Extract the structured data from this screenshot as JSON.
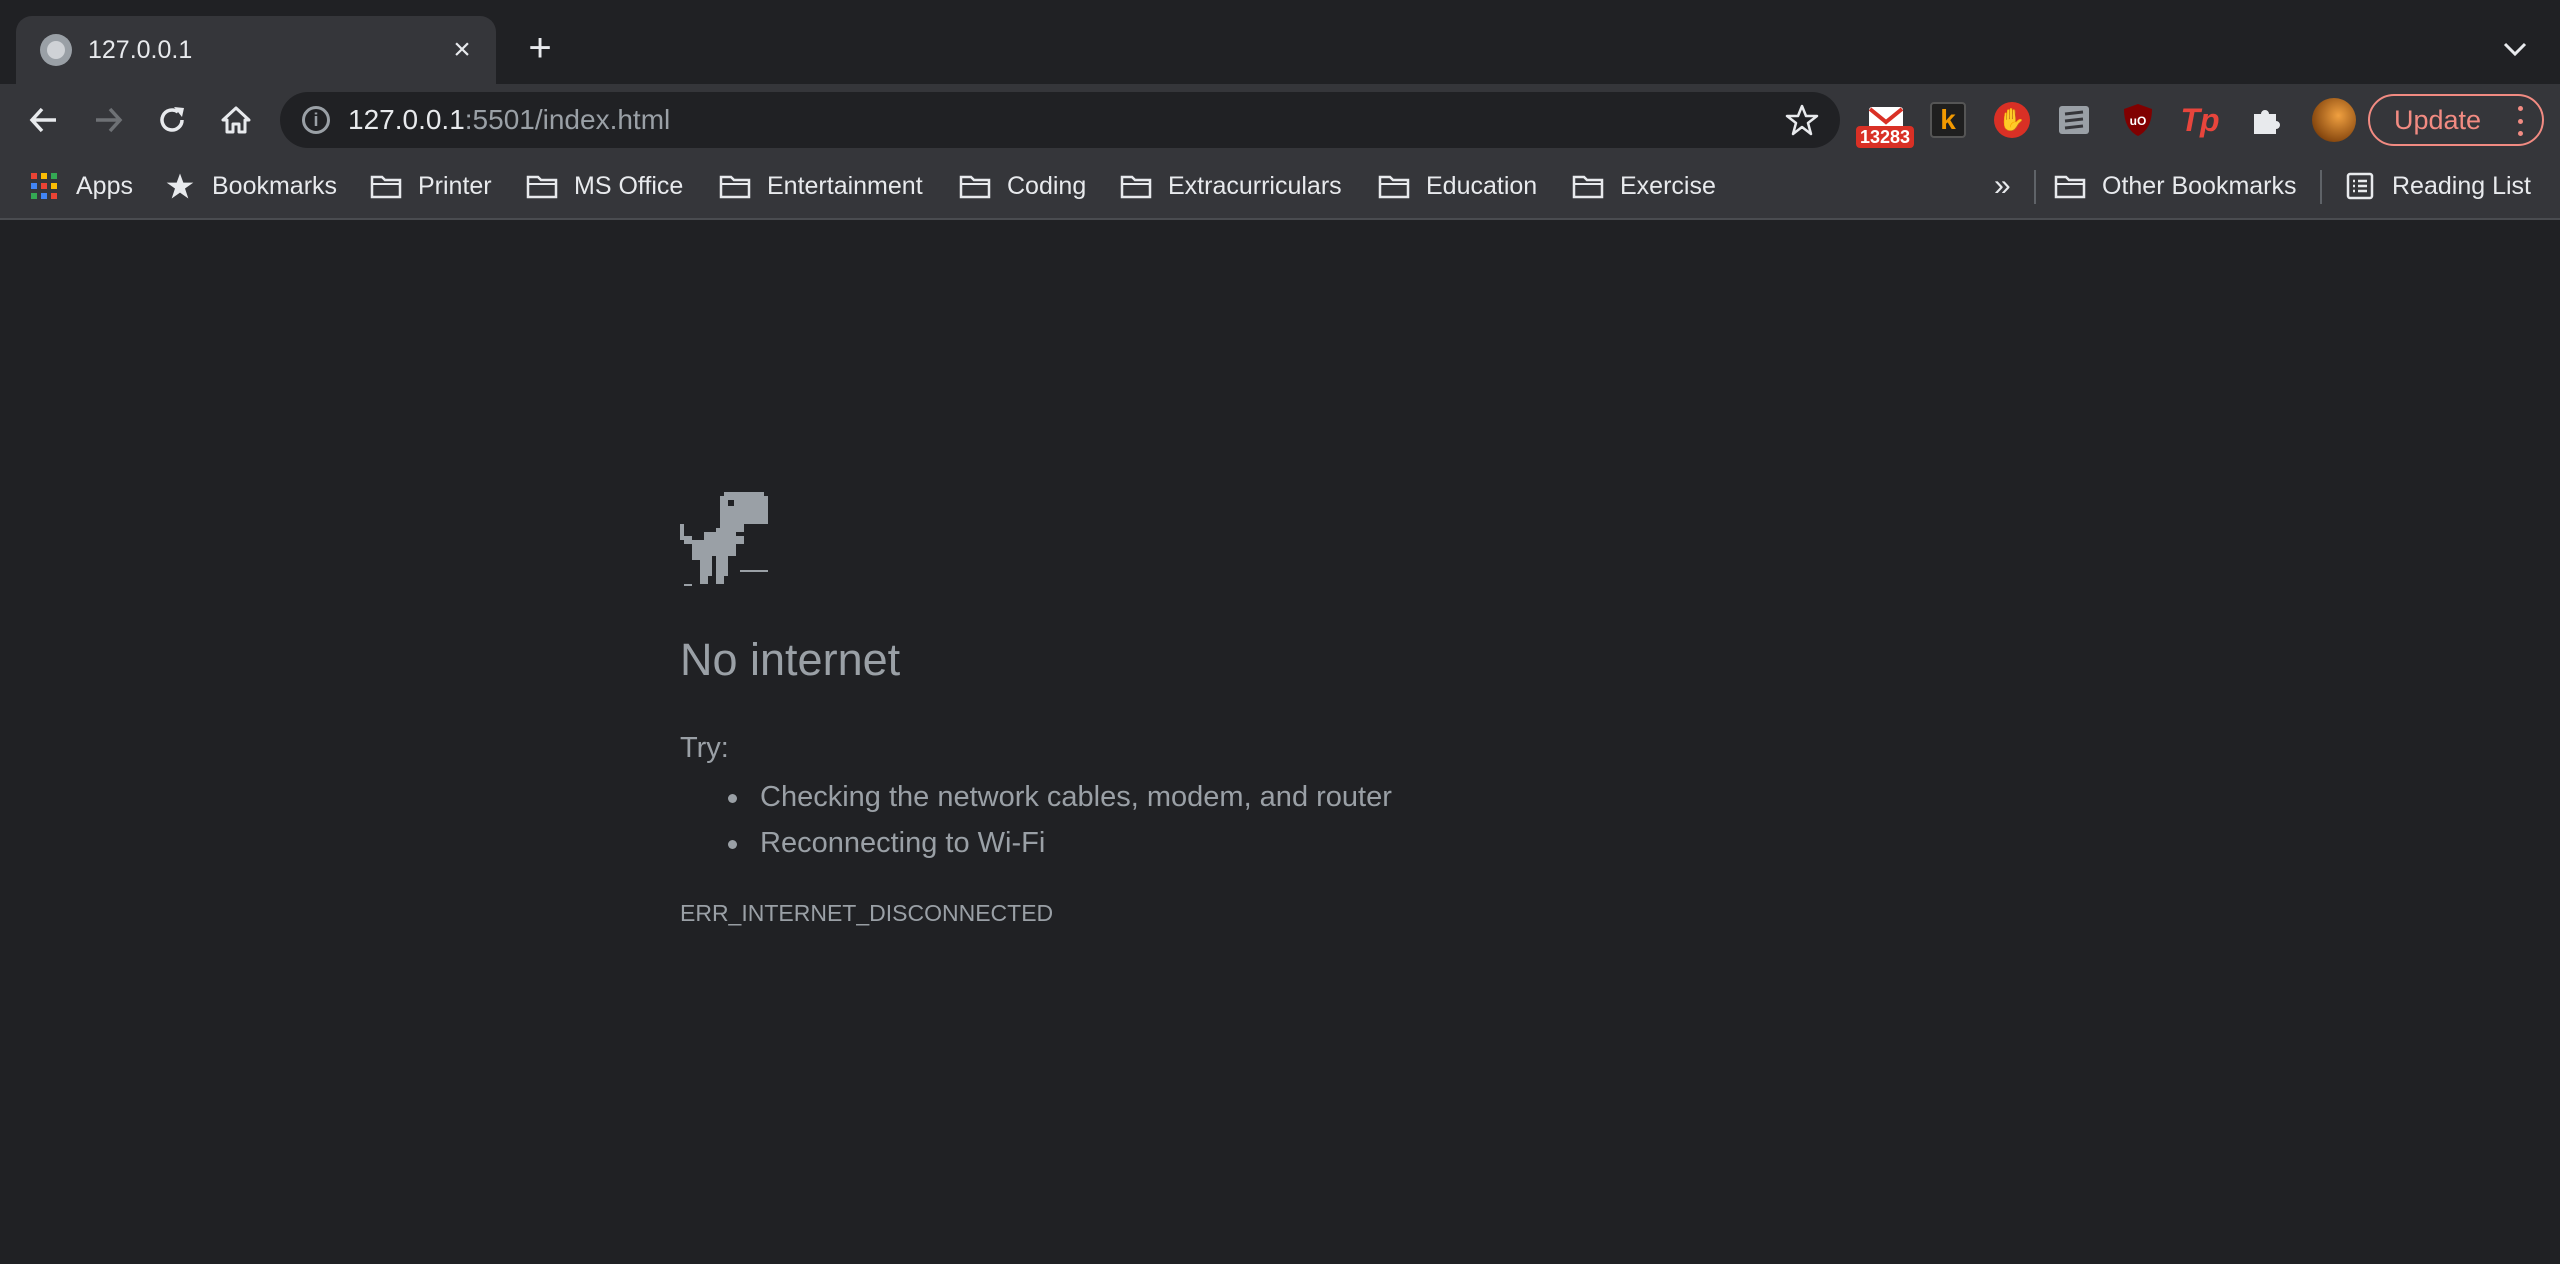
{
  "tab": {
    "title": "127.0.0.1",
    "close_icon": "×",
    "new_tab_icon": "+"
  },
  "omnibox": {
    "host": "127.0.0.1",
    "rest": ":5501/index.html"
  },
  "extensions": {
    "gmail_badge": "13283",
    "k_label": "k",
    "ubo_label": "uO",
    "tp_label": "Tp"
  },
  "update_button": {
    "label": "Update"
  },
  "bookmarks": {
    "apps": "Apps",
    "bookmarks": "Bookmarks",
    "printer": "Printer",
    "ms_office": "MS Office",
    "entertainment": "Entertainment",
    "coding": "Coding",
    "extracurriculars": "Extracurriculars",
    "education": "Education",
    "exercise": "Exercise",
    "overflow": "»",
    "other": "Other Bookmarks",
    "reading_list": "Reading List"
  },
  "error_page": {
    "title": "No internet",
    "try_label": "Try:",
    "suggestions": [
      "Checking the network cables, modem, and router",
      "Reconnecting to Wi-Fi"
    ],
    "code": "ERR_INTERNET_DISCONNECTED"
  },
  "colors": {
    "background": "#202124",
    "toolbar": "#35363a",
    "update_accent": "#f28b82",
    "muted_text": "#9aa0a6"
  }
}
